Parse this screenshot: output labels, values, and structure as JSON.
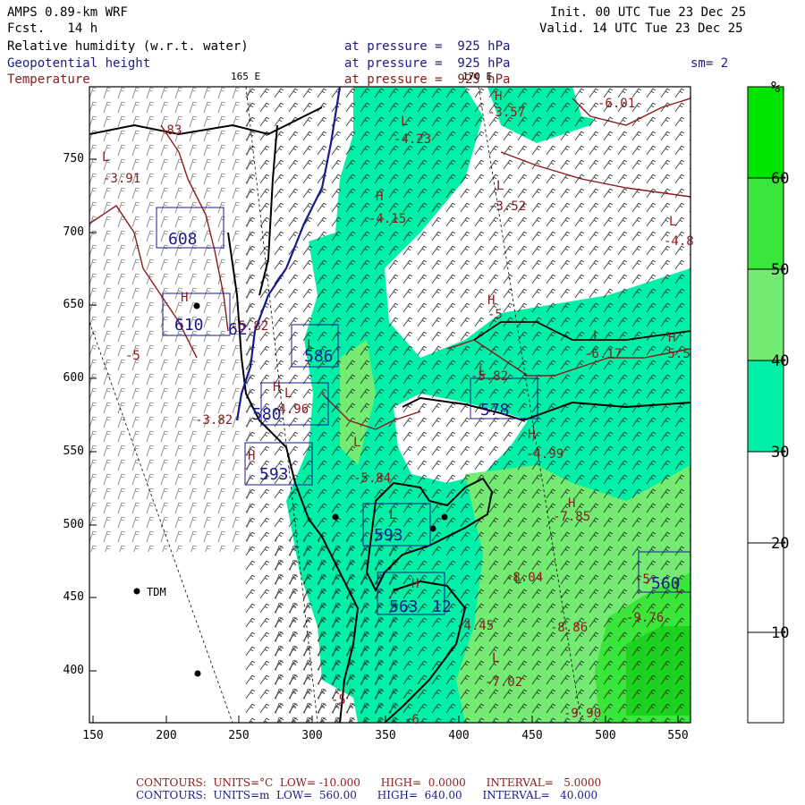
{
  "header": {
    "model": "AMPS 0.89-km WRF",
    "fcst": "Fcst.   14 h",
    "init": "Init. 00 UTC Tue 23 Dec 25",
    "valid": "Valid. 14 UTC Tue 23 Dec 25",
    "fields": [
      {
        "name": "Relative humidity (w.r.t. water)",
        "level": "at pressure =  925 hPa",
        "color": "#000000"
      },
      {
        "name": "Geopotential height",
        "level": "at pressure =  925 hPa",
        "color": "#1a1a8c"
      },
      {
        "name": "Temperature",
        "level": "at pressure =  925 hPa",
        "color": "#8b1a1a"
      }
    ],
    "smoothing": "sm= 2",
    "lon_165": "165 E",
    "lon_170": "170 E"
  },
  "map_axes": {
    "x_ticks": [
      "150",
      "200",
      "250",
      "300",
      "350",
      "400",
      "450",
      "500",
      "550"
    ],
    "y_ticks": [
      "750",
      "700",
      "650",
      "600",
      "550",
      "500",
      "450",
      "400"
    ],
    "station": "TDM"
  },
  "labels": {
    "temperature": [
      {
        "t": "-3.57"
      },
      {
        "t": "-4.23"
      },
      {
        "t": "-6.01"
      },
      {
        "t": "-4.15"
      },
      {
        "t": "-3.52"
      },
      {
        "t": "-4.8"
      },
      {
        "t": "-5"
      },
      {
        "t": "-6.17"
      },
      {
        "t": "-5.5"
      },
      {
        "t": "-3.82"
      },
      {
        "t": "-4.96"
      },
      {
        "t": "-5.82"
      },
      {
        "t": "-4.99"
      },
      {
        "t": "-5.84"
      },
      {
        "t": "-7.85"
      },
      {
        "t": "-8.04"
      },
      {
        "t": "-4.45"
      },
      {
        "t": "-8.86"
      },
      {
        "t": "-9.76"
      },
      {
        "t": "-7.02"
      },
      {
        "t": "-9.90"
      },
      {
        "t": "-5"
      },
      {
        "t": "-3.91"
      },
      {
        "t": "-83"
      },
      {
        "t": "-5.82"
      },
      {
        "t": "-5"
      },
      {
        "t": "-5"
      },
      {
        "t": "-6"
      }
    ],
    "highs_lows": [
      {
        "t": "H"
      },
      {
        "t": "L"
      },
      {
        "t": "L"
      },
      {
        "t": "H"
      },
      {
        "t": "L"
      },
      {
        "t": "H"
      },
      {
        "t": "L"
      },
      {
        "t": "H"
      },
      {
        "t": "L"
      },
      {
        "t": "H"
      },
      {
        "t": "L"
      },
      {
        "t": "L"
      },
      {
        "t": "H"
      },
      {
        "t": "L"
      },
      {
        "t": "H"
      },
      {
        "t": "L"
      },
      {
        "t": "H"
      },
      {
        "t": "L"
      },
      {
        "t": "L"
      },
      {
        "t": "H"
      },
      {
        "t": "L"
      },
      {
        "t": "L"
      },
      {
        "t": "H"
      }
    ],
    "heights": [
      {
        "t": "608"
      },
      {
        "t": "610"
      },
      {
        "t": "586"
      },
      {
        "t": "580"
      },
      {
        "t": "593"
      },
      {
        "t": "578"
      },
      {
        "t": "593"
      },
      {
        "t": "563"
      },
      {
        "t": "560"
      },
      {
        "t": "62"
      },
      {
        "t": "12"
      }
    ]
  },
  "colorbar": {
    "unit": "%",
    "labels": [
      "60",
      "50",
      "40",
      "30",
      "20",
      "10"
    ],
    "colors": [
      "#00e600",
      "#39e639",
      "#74ec74",
      "#00f0a8",
      "#ffffff",
      "#ffffff",
      "#ffffff"
    ]
  },
  "footer": {
    "line1": "CONTOURS:  UNITS=°C  LOW= -10.000      HIGH=  0.0000      INTERVAL=   5.0000",
    "line2": "CONTOURS:  UNITS=m  LOW=  560.00      HIGH=  640.00      INTERVAL=   40.000",
    "line1_color": "#8b1a1a",
    "line2_color": "#1a1a8c"
  }
}
